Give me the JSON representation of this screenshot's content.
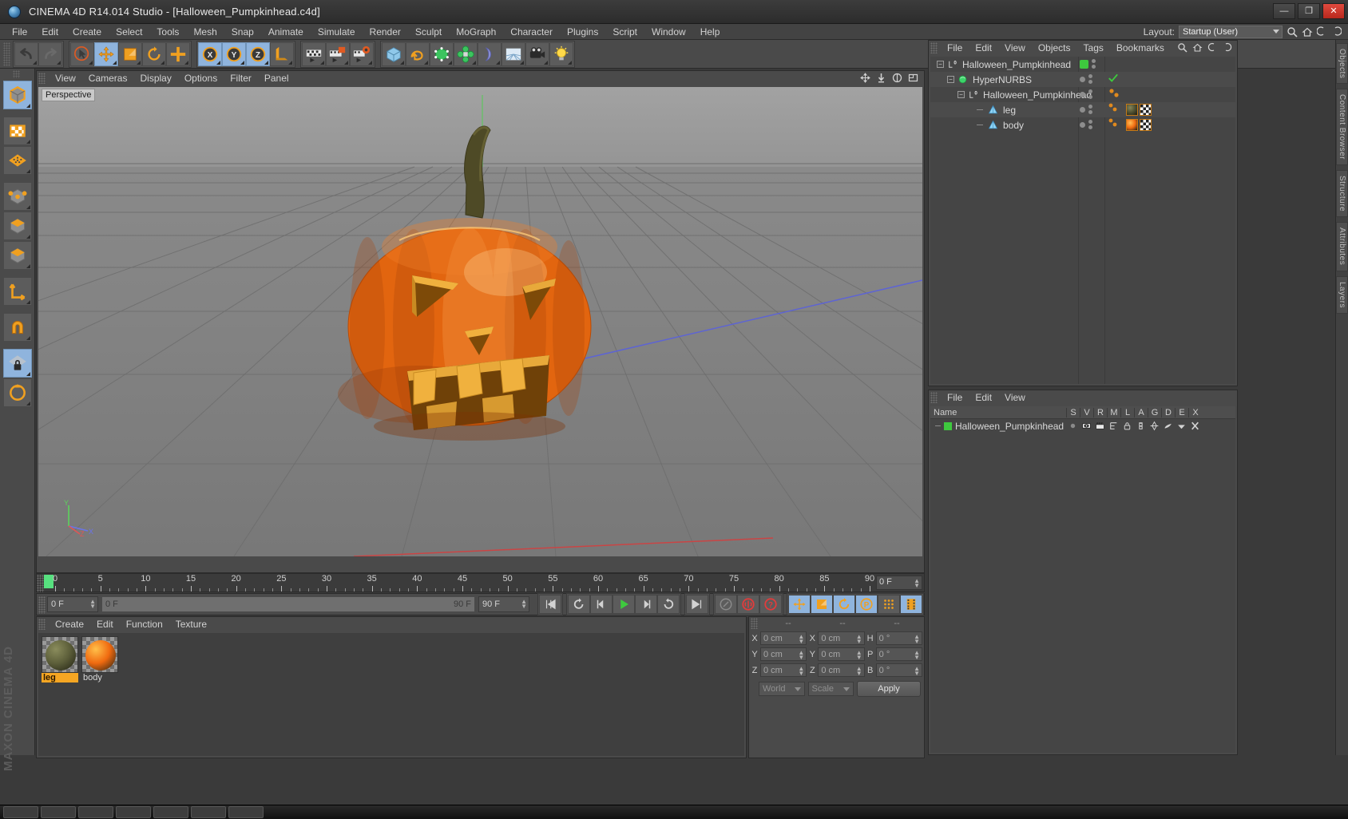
{
  "window": {
    "title": "CINEMA 4D R14.014 Studio - [Halloween_Pumpkinhead.c4d]",
    "logo_icon": "cinema4d-logo-icon",
    "minimize_label": "—",
    "maximize_label": "❐",
    "close_label": "✕"
  },
  "menubar": {
    "items": [
      {
        "label": "File"
      },
      {
        "label": "Edit"
      },
      {
        "label": "Create"
      },
      {
        "label": "Select"
      },
      {
        "label": "Tools"
      },
      {
        "label": "Mesh"
      },
      {
        "label": "Snap"
      },
      {
        "label": "Animate"
      },
      {
        "label": "Simulate"
      },
      {
        "label": "Render"
      },
      {
        "label": "Sculpt"
      },
      {
        "label": "MoGraph"
      },
      {
        "label": "Character"
      },
      {
        "label": "Plugins"
      },
      {
        "label": "Script"
      },
      {
        "label": "Window"
      },
      {
        "label": "Help"
      }
    ],
    "layout_label": "Layout:",
    "layout_value": "Startup (User)",
    "search_icon": "search-icon",
    "home_icon": "home-icon",
    "left_arrow_icon": "left-arrow-icon",
    "right_arrow_icon": "right-arrow-icon"
  },
  "toolbar": {
    "groups": [
      {
        "name": "history",
        "buttons": [
          {
            "icon": "undo-icon",
            "active": false
          },
          {
            "icon": "redo-icon",
            "active": false
          }
        ]
      },
      {
        "name": "transform",
        "buttons": [
          {
            "icon": "select-arrow-icon",
            "active": false
          },
          {
            "icon": "move-icon",
            "active": true
          },
          {
            "icon": "scale-icon",
            "active": false
          },
          {
            "icon": "rotate-icon",
            "active": false
          },
          {
            "icon": "plus-tool-icon",
            "active": false
          }
        ]
      },
      {
        "name": "axis-lock",
        "buttons": [
          {
            "icon": "lock-x-axis-icon",
            "active": true
          },
          {
            "icon": "lock-y-axis-icon",
            "active": true
          },
          {
            "icon": "lock-z-axis-icon",
            "active": true
          },
          {
            "icon": "world-coordinate-icon",
            "active": false
          }
        ]
      },
      {
        "name": "render",
        "buttons": [
          {
            "icon": "render-view-icon",
            "active": false
          },
          {
            "icon": "render-to-picture-viewer-icon",
            "active": false
          },
          {
            "icon": "render-settings-icon",
            "active": false
          }
        ]
      },
      {
        "name": "create",
        "buttons": [
          {
            "icon": "cube-primitive-icon",
            "active": false
          },
          {
            "icon": "spline-pen-icon",
            "active": false
          },
          {
            "icon": "nurbs-generator-icon",
            "active": false
          },
          {
            "icon": "array-modeling-icon",
            "active": false
          },
          {
            "icon": "deformer-bend-icon",
            "active": false
          },
          {
            "icon": "environment-floor-icon",
            "active": false
          },
          {
            "icon": "camera-icon",
            "active": false
          },
          {
            "icon": "light-icon",
            "active": false
          }
        ]
      }
    ]
  },
  "leftbar": {
    "buttons": [
      {
        "icon": "model-mode-icon",
        "active": true
      },
      {
        "icon": "texture-mode-icon",
        "active": false
      },
      {
        "icon": "polygon-grid-icon",
        "active": false
      },
      {
        "icon": "points-mode-icon",
        "active": false
      },
      {
        "icon": "edges-mode-icon",
        "active": false
      },
      {
        "icon": "polygons-mode-icon",
        "active": false
      },
      {
        "icon": "axis-modify-icon",
        "active": false
      },
      {
        "icon": "magnet-tool-icon",
        "active": false
      },
      {
        "icon": "lock-workplane-icon",
        "active": true
      },
      {
        "icon": "workplane-rotate-icon",
        "active": false
      }
    ]
  },
  "viewport": {
    "menu": [
      {
        "label": "View"
      },
      {
        "label": "Cameras"
      },
      {
        "label": "Display"
      },
      {
        "label": "Options"
      },
      {
        "label": "Filter"
      },
      {
        "label": "Panel"
      }
    ],
    "view_label": "Perspective",
    "nav_icons": [
      "pan-view-icon",
      "dolly-view-icon",
      "orbit-view-icon",
      "maximize-view-icon"
    ],
    "axis_labels": {
      "y": "Y",
      "x": "X",
      "z": "Z"
    },
    "scene_object": "Halloween pumpkin jack-o-lantern with carved triangular eyes, nose and toothy mouth, with a green-brown stem"
  },
  "timeline": {
    "ruler_start": 0,
    "ruler_end": 90,
    "ruler_labels": [
      "0",
      "5",
      "10",
      "15",
      "20",
      "25",
      "30",
      "35",
      "40",
      "45",
      "50",
      "55",
      "60",
      "65",
      "70",
      "75",
      "80",
      "85",
      "90"
    ],
    "current_frame_display": "0 F",
    "playhead_frame": 0,
    "start_field": "0 F",
    "range_left": "0 F",
    "range_right": "90 F",
    "end_field": "90 F",
    "controls": [
      {
        "icon": "go-to-start-icon",
        "label": "⏮"
      },
      {
        "icon": "play-backwards-icon",
        "label": "↺"
      },
      {
        "icon": "step-back-icon",
        "label": "◀|"
      },
      {
        "icon": "play-forward-icon",
        "label": "▶"
      },
      {
        "icon": "step-forward-icon",
        "label": "|▶"
      },
      {
        "icon": "loop-icon",
        "label": "↻"
      },
      {
        "icon": "go-to-end-icon",
        "label": "⏭"
      }
    ],
    "record_controls": [
      {
        "icon": "autokeying-icon"
      },
      {
        "icon": "record-active-objects-icon"
      },
      {
        "icon": "keyframe-selection-icon"
      }
    ],
    "key_toggles": [
      {
        "icon": "position-key-icon",
        "active": true
      },
      {
        "icon": "scale-key-icon",
        "active": true
      },
      {
        "icon": "rotation-key-icon",
        "active": true
      },
      {
        "icon": "parameter-key-icon",
        "active": true
      },
      {
        "icon": "point-level-animation-icon",
        "active": false
      },
      {
        "icon": "animation-layer-icon",
        "active": true
      }
    ]
  },
  "material_manager": {
    "menu": [
      {
        "label": "Create"
      },
      {
        "label": "Edit"
      },
      {
        "label": "Function"
      },
      {
        "label": "Texture"
      }
    ],
    "materials": [
      {
        "name": "leg",
        "selected": true,
        "color": "#5d5f3a",
        "highlight": "#8a8c5c"
      },
      {
        "name": "body",
        "selected": false,
        "color": "#f06a10",
        "highlight": "#ffc04a"
      }
    ]
  },
  "coordinates": {
    "headers": [
      "--",
      "--",
      "--"
    ],
    "rows": [
      {
        "pos_label": "X",
        "pos_value": "0 cm",
        "size_label": "X",
        "size_value": "0 cm",
        "rot_label": "H",
        "rot_value": "0 °"
      },
      {
        "pos_label": "Y",
        "pos_value": "0 cm",
        "size_label": "Y",
        "size_value": "0 cm",
        "rot_label": "P",
        "rot_value": "0 °"
      },
      {
        "pos_label": "Z",
        "pos_value": "0 cm",
        "size_label": "Z",
        "size_value": "0 cm",
        "rot_label": "B",
        "rot_value": "0 °"
      }
    ],
    "system_value": "World",
    "mode_value": "Scale",
    "apply_label": "Apply"
  },
  "object_manager": {
    "menu": [
      {
        "label": "File"
      },
      {
        "label": "Edit"
      },
      {
        "label": "View"
      },
      {
        "label": "Objects"
      },
      {
        "label": "Tags"
      },
      {
        "label": "Bookmarks"
      }
    ],
    "tools": [
      "search-icon",
      "home-icon",
      "back-icon",
      "forward-icon"
    ],
    "tree": [
      {
        "name": "Halloween_Pumpkinhead",
        "depth": 0,
        "icon": "null-object-icon",
        "expanded": true,
        "selected": false,
        "enabled_dot": "green",
        "tags": []
      },
      {
        "name": "HyperNURBS",
        "depth": 1,
        "icon": "hypernurbs-icon",
        "expanded": true,
        "selected": false,
        "enabled_dot": "gray",
        "tags": [
          "check-green-icon"
        ]
      },
      {
        "name": "Halloween_Pumpkinhead",
        "depth": 2,
        "icon": "null-object-icon",
        "expanded": true,
        "selected": false,
        "enabled_dot": "gray",
        "tags": [
          "orange-dots-icon"
        ]
      },
      {
        "name": "leg",
        "depth": 3,
        "icon": "polygon-object-icon",
        "expanded": false,
        "selected": false,
        "enabled_dot": "gray",
        "tags": [
          "material-tag-leg",
          "uvw-tag"
        ]
      },
      {
        "name": "body",
        "depth": 3,
        "icon": "polygon-object-icon",
        "expanded": false,
        "selected": false,
        "enabled_dot": "gray",
        "tags": [
          "material-tag-body",
          "uvw-tag"
        ]
      }
    ]
  },
  "attribute_manager": {
    "menu": [
      {
        "label": "File"
      },
      {
        "label": "Edit"
      },
      {
        "label": "View"
      }
    ],
    "columns": [
      "Name",
      "S",
      "V",
      "R",
      "M",
      "L",
      "A",
      "G",
      "D",
      "E",
      "X"
    ],
    "rows": [
      {
        "name": "Halloween_Pumpkinhead",
        "color": "#3ec93e",
        "cells": [
          {
            "icon": "solo-dot-icon"
          },
          {
            "icon": "visible-eye-icon"
          },
          {
            "icon": "render-clapper-icon"
          },
          {
            "icon": "manager-tree-icon"
          },
          {
            "icon": "lock-icon"
          },
          {
            "icon": "animation-icon"
          },
          {
            "icon": "generators-icon"
          },
          {
            "icon": "deformers-icon"
          },
          {
            "icon": "expressions-icon"
          },
          {
            "icon": "xref-icon"
          }
        ]
      }
    ]
  },
  "right_dock": {
    "tabs": [
      "Objects",
      "Content Browser",
      "Structure",
      "Attributes",
      "Layers"
    ]
  },
  "watermark": "MAXON CINEMA 4D"
}
